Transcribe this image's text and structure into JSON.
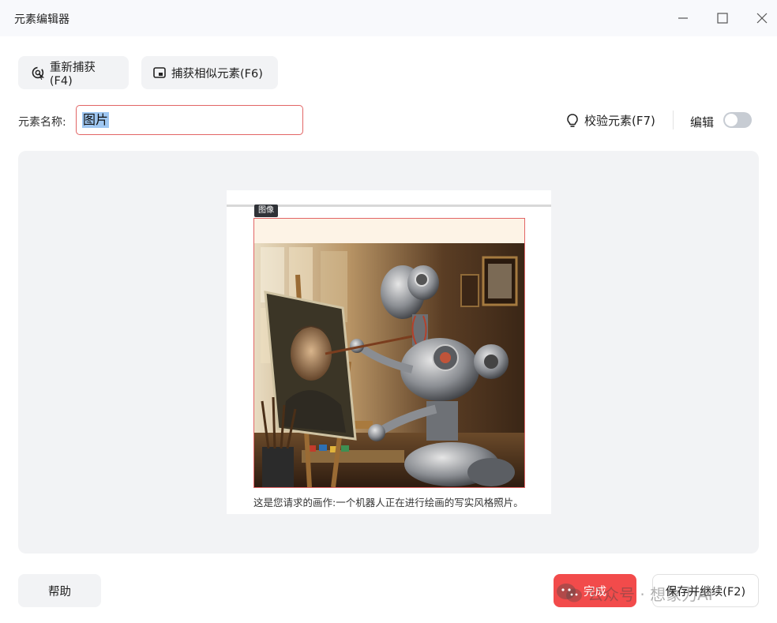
{
  "window": {
    "title": "元素编辑器"
  },
  "toolbar": {
    "recapture_label": "重新捕获(F4)",
    "capture_similar_label": "捕获相似元素(F6)"
  },
  "element_name": {
    "label": "元素名称:",
    "value": "图片"
  },
  "validate_label": "校验元素(F7)",
  "edit": {
    "label": "编辑",
    "enabled": false
  },
  "preview": {
    "tag": "图像",
    "caption": "这是您请求的画作:一个机器人正在进行绘画的写实风格照片。"
  },
  "footer": {
    "help_label": "帮助",
    "done_label": "完成",
    "save_continue_label": "保存并继续(F2)"
  },
  "watermark": {
    "text": "公众号 · 想象力AI"
  },
  "colors": {
    "accent": "#f24b4b",
    "selection_border": "#e26565",
    "text_selection": "#9fc7f2"
  }
}
